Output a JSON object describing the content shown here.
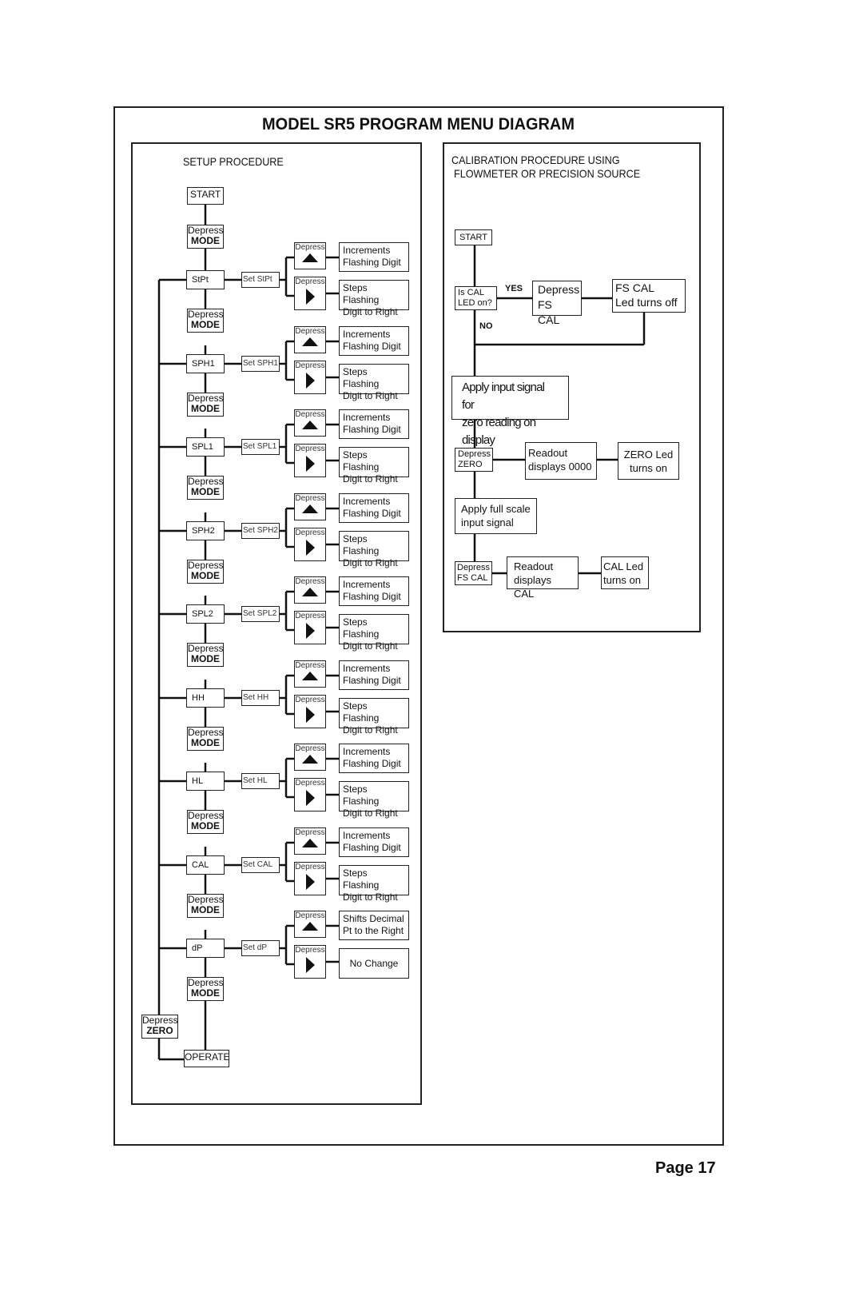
{
  "title": "MODEL SR5 PROGRAM MENU DIAGRAM",
  "page_label": "Page 17",
  "setup": {
    "heading": "SETUP PROCEDURE",
    "start": "START",
    "depress": "Depress",
    "mode": "MODE",
    "zero": "ZERO",
    "operate": "OPERATE",
    "up_icon": "triangle-up-icon",
    "right_icon": "triangle-right-icon",
    "items": [
      {
        "menu": "StPt",
        "set": "Set StPt",
        "up_result": "Increments\nFlashing Digit",
        "right_result": "Steps Flashing\nDigit to Right"
      },
      {
        "menu": "SPH1",
        "set": "Set SPH1",
        "up_result": "Increments\nFlashing Digit",
        "right_result": "Steps Flashing\nDigit to Right"
      },
      {
        "menu": "SPL1",
        "set": "Set SPL1",
        "up_result": "Increments\nFlashing Digit",
        "right_result": "Steps Flashing\nDigit to Right"
      },
      {
        "menu": "SPH2",
        "set": "Set SPH2",
        "up_result": "Increments\nFlashing Digit",
        "right_result": "Steps Flashing\nDigit to Right"
      },
      {
        "menu": "SPL2",
        "set": "Set SPL2",
        "up_result": "Increments\nFlashing Digit",
        "right_result": "Steps Flashing\nDigit to Right"
      },
      {
        "menu": "HH",
        "set": "Set HH",
        "up_result": "Increments\nFlashing Digit",
        "right_result": "Steps Flashing\nDigit to Right"
      },
      {
        "menu": "HL",
        "set": "Set HL",
        "up_result": "Increments\nFlashing Digit",
        "right_result": "Steps Flashing\nDigit to Right"
      },
      {
        "menu": "CAL",
        "set": "Set CAL",
        "up_result": "Increments\nFlashing Digit",
        "right_result": "Steps Flashing\nDigit to Right"
      },
      {
        "menu": "dP",
        "set": "Set dP",
        "up_result": "Shifts Decimal\nPt to the Right",
        "right_result": "No Change"
      }
    ]
  },
  "calibration": {
    "heading_line1": "CALIBRATION PROCEDURE USING",
    "heading_line2": "FLOWMETER OR PRECISION SOURCE",
    "start": "START",
    "is_cal_led": "Is CAL\nLED on?",
    "yes": "YES",
    "no": "NO",
    "depress_fs_cal_big": "Depress\nFS CAL",
    "fs_cal_led_off": "FS CAL\nLed turns off",
    "apply_zero": "Apply input signal for\nzero reading on display",
    "depress_zero": "Depress\nZERO",
    "readout_0000": "Readout\ndisplays 0000",
    "zero_led_on": "ZERO Led\nturns on",
    "apply_full": "Apply full scale\ninput signal",
    "depress_fs_cal": "Depress\nFS CAL",
    "readout_cal": "Readout\ndisplays CAL",
    "cal_led_on": "CAL Led\nturns on"
  }
}
